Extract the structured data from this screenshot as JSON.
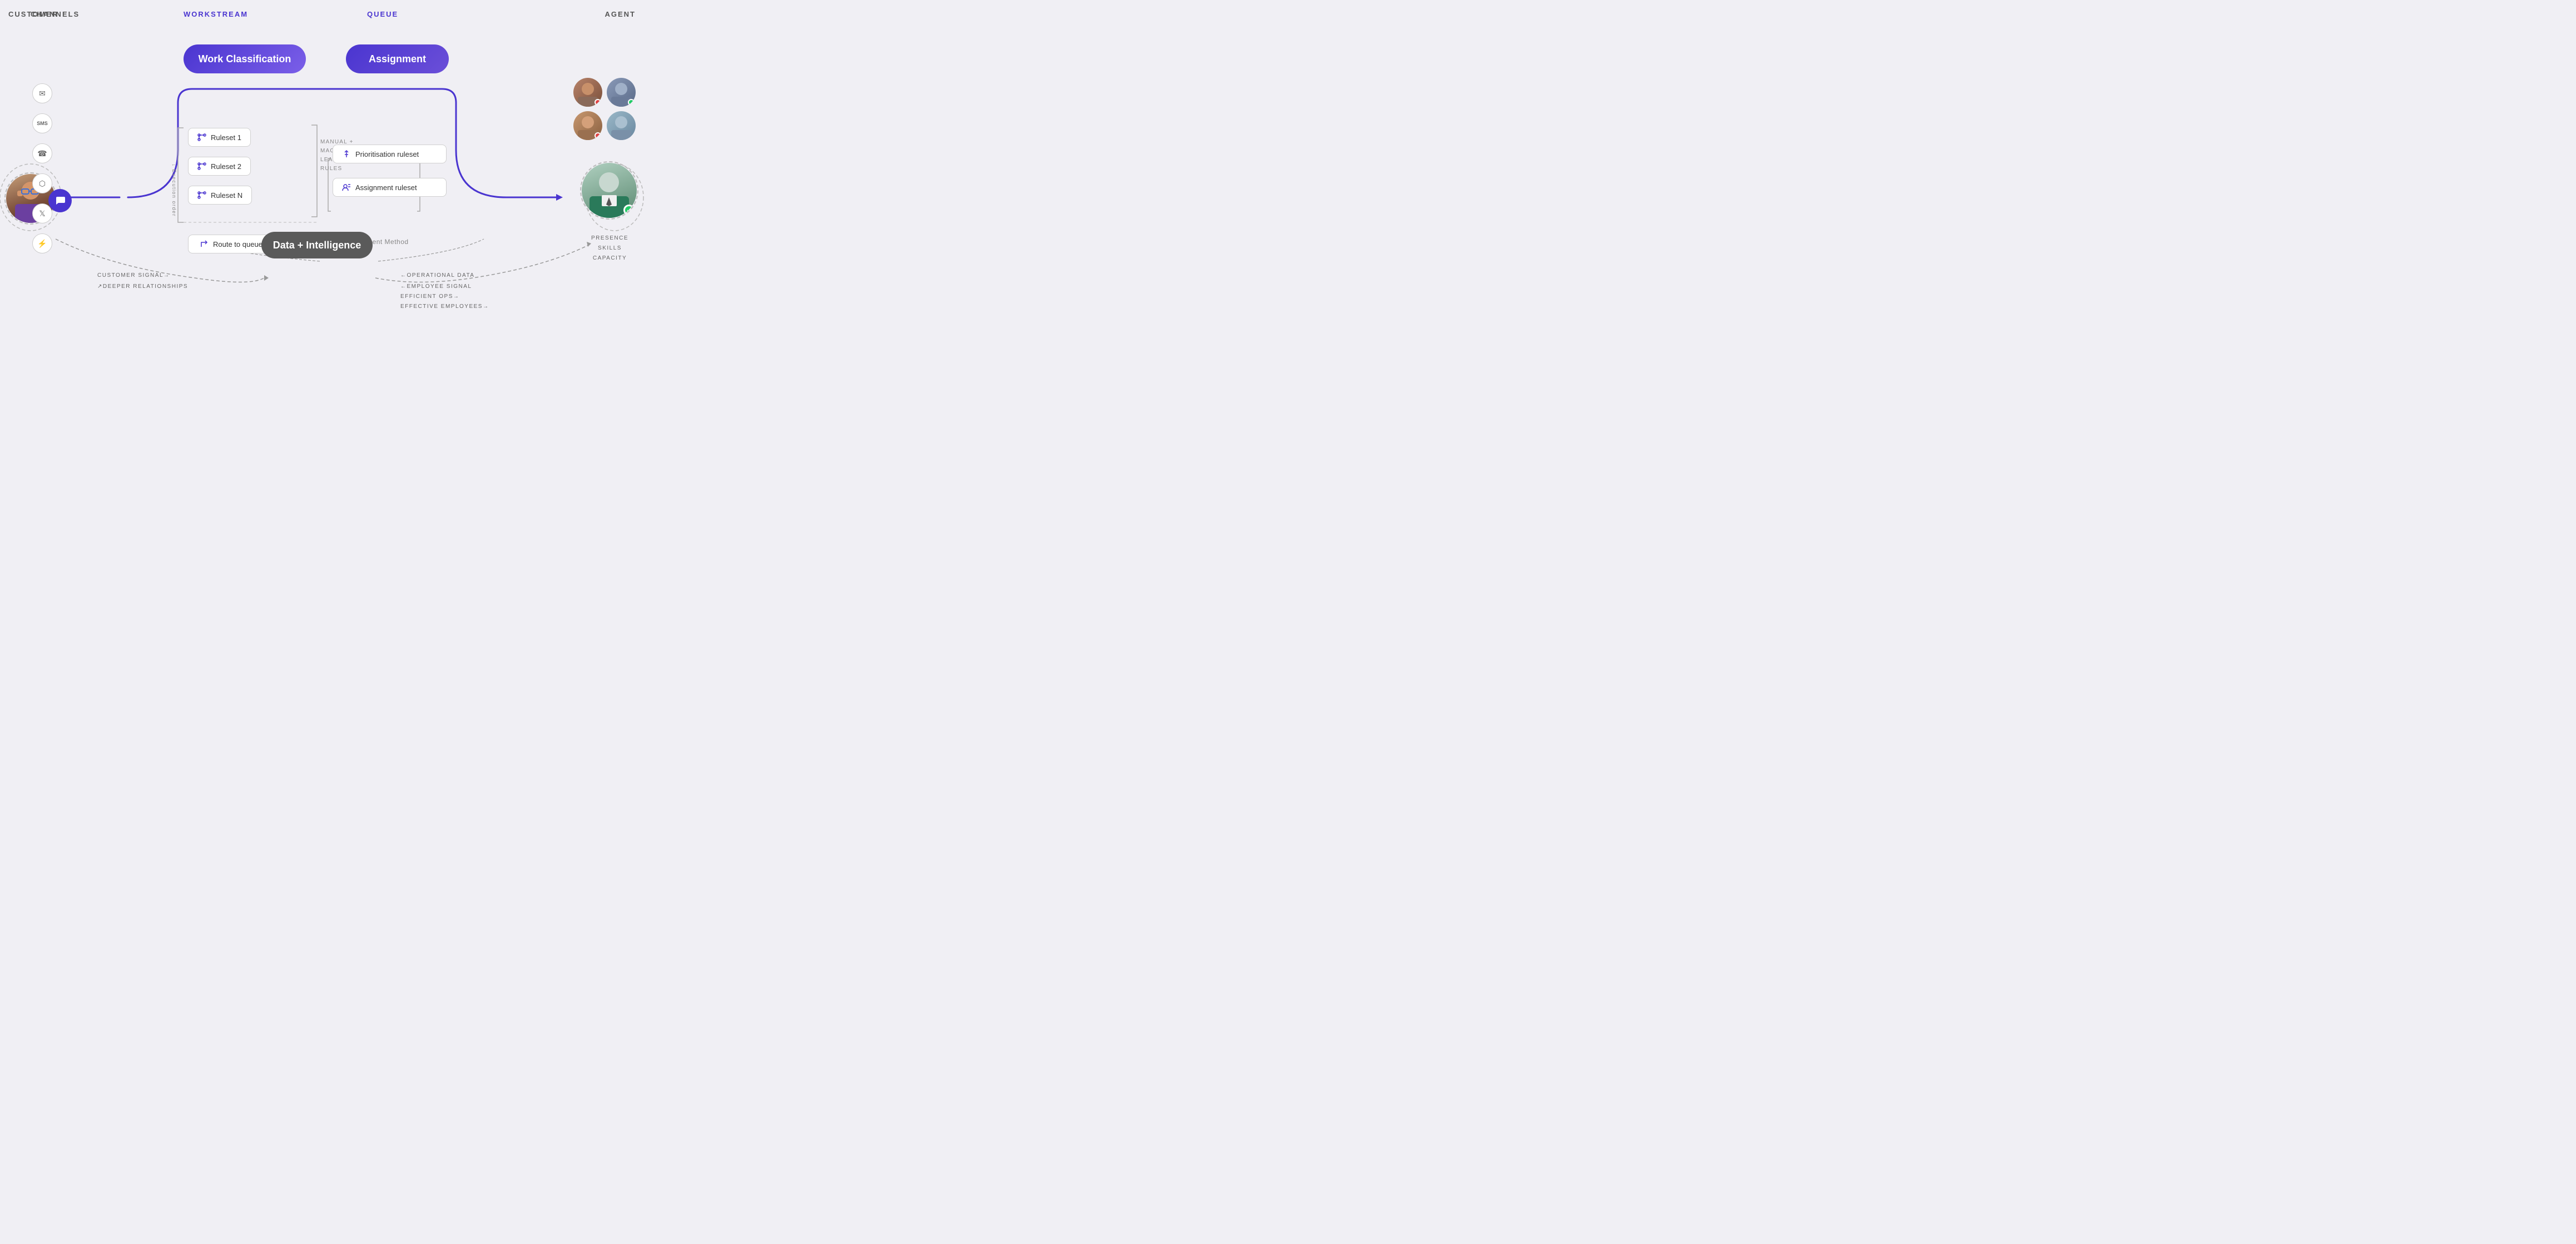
{
  "headers": {
    "customer": "CUSTOMER",
    "channels": "CHANNELS",
    "workstream": "WORKSTREAM",
    "queue": "QUEUE",
    "agent": "AGENT"
  },
  "pills": {
    "work_classification": "Work Classification",
    "assignment": "Assignment",
    "data_intelligence": "Data + Intelligence"
  },
  "rulesets": {
    "ruleset1": "Ruleset 1",
    "ruleset2": "Ruleset 2",
    "rulesetN": "Ruleset N",
    "route_to_queue": "Route to queue ruleset",
    "ml_label_line1": "MANUAL +",
    "ml_label_line2": "MACHINE",
    "ml_label_line3": "LEARNING",
    "ml_label_line4": "RULES",
    "execution_order": "↓ Execution order"
  },
  "assignment_section": {
    "prioritisation": "Prioritisation ruleset",
    "assignment_ruleset": "Assignment ruleset",
    "assignment_method": "Assignment Method"
  },
  "agent_labels": {
    "presence": "PRESENCE",
    "skills": "SKILLS",
    "capacity": "CAPACITY"
  },
  "data_flows": {
    "customer_signal": "CUSTOMER SIGNAL→",
    "deeper_relationships": "↗DEEPER RELATIONSHIPS",
    "operational_data": "←OPERATIONAL DATA",
    "employee_signal": "←EMPLOYEE SIGNAL",
    "efficient_ops": "EFFICIENT OPS→",
    "effective_employees": "EFFECTIVE EMPLOYEES→"
  }
}
